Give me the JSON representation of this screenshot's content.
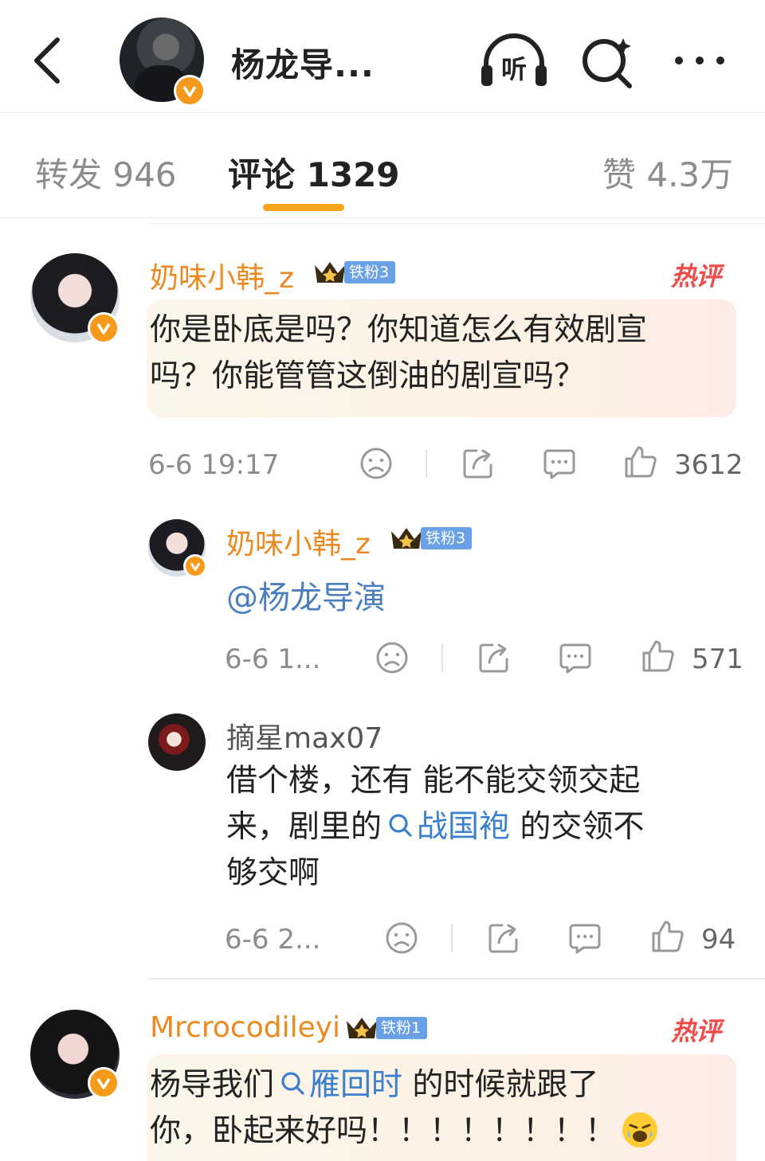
{
  "header": {
    "title": "杨龙导...",
    "listen_label": "听"
  },
  "tabs": {
    "repost": "转发 946",
    "comments": "评论 1329",
    "likes": "赞 4.3万"
  },
  "comments": [
    {
      "username": "奶味小韩_z",
      "fan_badge": "铁粉3",
      "hot_label": "热评",
      "text": "你是卧底是吗？你知道怎么有效剧宣吗？你能管管这倒油的剧宣吗？",
      "time": "6-6 19:17",
      "likes": "3612"
    },
    {
      "username": "奶味小韩_z",
      "fan_badge": "铁粉3",
      "text": "@杨龙导演",
      "time": "6-6 1...",
      "likes": "571"
    },
    {
      "username": "摘星max07",
      "text_line1": "借个楼，还有 能不能交领交起",
      "text_line2a": "来，剧里的",
      "link": "战国袍",
      "text_line2b": " 的交领不",
      "text_line3": "够交啊",
      "time": "6-6 2...",
      "likes": "94"
    },
    {
      "username": "Mrcrocodileyi",
      "fan_badge": "铁粉1",
      "hot_label": "热评",
      "text_a": "杨导我们",
      "link": "雁回时",
      "text_b": " 的时候就跟了",
      "text_line2": "你，卧起来好吗！！！！！！！！"
    }
  ],
  "colors": {
    "username": "#ed8a1f",
    "hot": "#ef4b4b",
    "link": "#3b7fcf",
    "tab_indicator": "#f7a51d",
    "verified": "#f59a1b"
  }
}
